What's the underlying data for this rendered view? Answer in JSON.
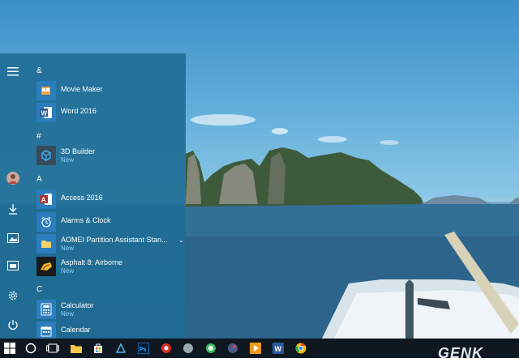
{
  "start_menu": {
    "groups": [
      {
        "letter": "&",
        "apps": [
          {
            "name": "Movie Maker",
            "icon": "movie-maker-icon",
            "new": ""
          },
          {
            "name": "Word 2016",
            "icon": "word-icon",
            "new": ""
          }
        ]
      },
      {
        "letter": "#",
        "apps": [
          {
            "name": "3D Builder",
            "icon": "3d-builder-icon",
            "new": "New"
          }
        ]
      },
      {
        "letter": "A",
        "apps": [
          {
            "name": "Access 2016",
            "icon": "access-icon",
            "new": ""
          },
          {
            "name": "Alarms & Clock",
            "icon": "alarm-clock-icon",
            "new": ""
          },
          {
            "name": "AOMEI Partition Assistant Stan...",
            "icon": "folder-icon",
            "new": "New"
          },
          {
            "name": "Asphalt 8: Airborne",
            "icon": "asphalt-icon",
            "new": "New"
          }
        ]
      },
      {
        "letter": "C",
        "apps": [
          {
            "name": "Calculator",
            "icon": "calculator-icon",
            "new": "New"
          },
          {
            "name": "Calendar",
            "icon": "calendar-icon",
            "new": ""
          }
        ]
      }
    ]
  },
  "watermark": "GENK",
  "colors": {
    "menu_bg": "#206e96",
    "tile_blue": "#2b7dbd",
    "new_text": "#8fd3ff",
    "taskbar": "#0f1720"
  }
}
